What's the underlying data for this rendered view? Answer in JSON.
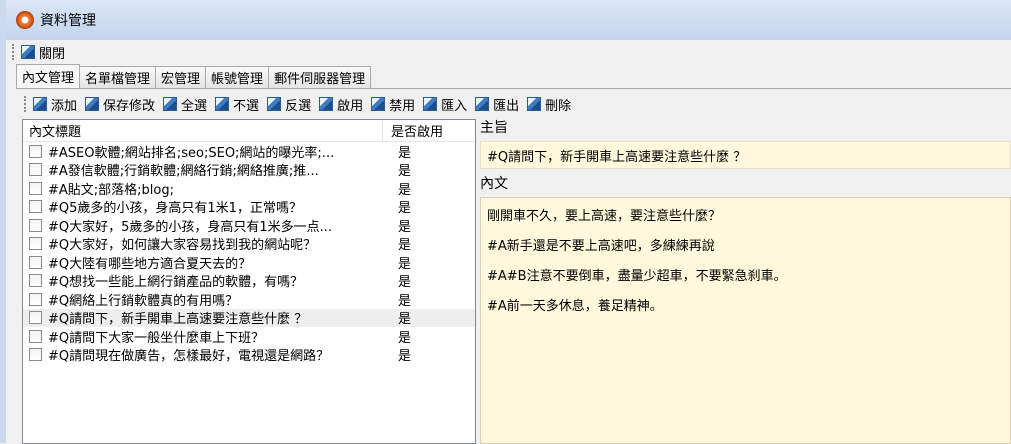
{
  "window": {
    "title": "資料管理",
    "app_icon": "gear-flower-icon"
  },
  "menubar": {
    "close_label": "關閉"
  },
  "tabs": [
    {
      "label": "內文管理"
    },
    {
      "label": "名單檔管理"
    },
    {
      "label": "宏管理"
    },
    {
      "label": "帳號管理"
    },
    {
      "label": "郵件伺服器管理"
    }
  ],
  "toolbar": {
    "add": "添加",
    "save": "保存修改",
    "select_all": "全選",
    "deselect": "不選",
    "invert": "反選",
    "enable": "啟用",
    "disable": "禁用",
    "import": "匯入",
    "export": "匯出",
    "delete": "刪除"
  },
  "list": {
    "col_title": "內文標題",
    "col_enabled": "是否啟用",
    "rows": [
      {
        "title": "#ASEO軟體;網站排名;seo;SEO;網站的曝光率;...",
        "enabled": "是"
      },
      {
        "title": "#A發信軟體;行銷軟體;網絡行銷;網絡推廣;推...",
        "enabled": "是"
      },
      {
        "title": "#A貼文;部落格;blog;",
        "enabled": "是"
      },
      {
        "title": "#Q5歲多的小孩，身高只有1米1，正常嗎？",
        "enabled": "是"
      },
      {
        "title": "#Q大家好，5歲多的小孩，身高只有1米多一点...",
        "enabled": "是"
      },
      {
        "title": "#Q大家好，如何讓大家容易找到我的網站呢？",
        "enabled": "是"
      },
      {
        "title": "#Q大陸有哪些地方適合夏天去的？",
        "enabled": "是"
      },
      {
        "title": "#Q想找一些能上網行銷產品的軟體，有嗎？",
        "enabled": "是"
      },
      {
        "title": "#Q網絡上行銷軟體真的有用嗎？",
        "enabled": "是"
      },
      {
        "title": "#Q請問下，新手開車上高速要注意些什麼 ？",
        "enabled": "是"
      },
      {
        "title": "#Q請問下大家一般坐什麼車上下班？",
        "enabled": "是"
      },
      {
        "title": "#Q請問現在做廣告，怎樣最好，電視還是網路？",
        "enabled": "是"
      }
    ]
  },
  "detail": {
    "subject_label": "主旨",
    "subject_value": "#Q請問下，新手開車上高速要注意些什麼 ？",
    "body_label": "內文",
    "body_lines": [
      "剛開車不久，要上高速，要注意些什麼？",
      "#A新手還是不要上高速吧，多練練再說",
      "#A#B注意不要倒車，盡量少超車，不要緊急刹車。",
      "#A前一天多休息，養足精神。"
    ]
  },
  "colors": {
    "editor_bg": "#fff8dc",
    "title_gradient_top": "#dbe6f5",
    "title_gradient_bottom": "#c3d5ee"
  }
}
